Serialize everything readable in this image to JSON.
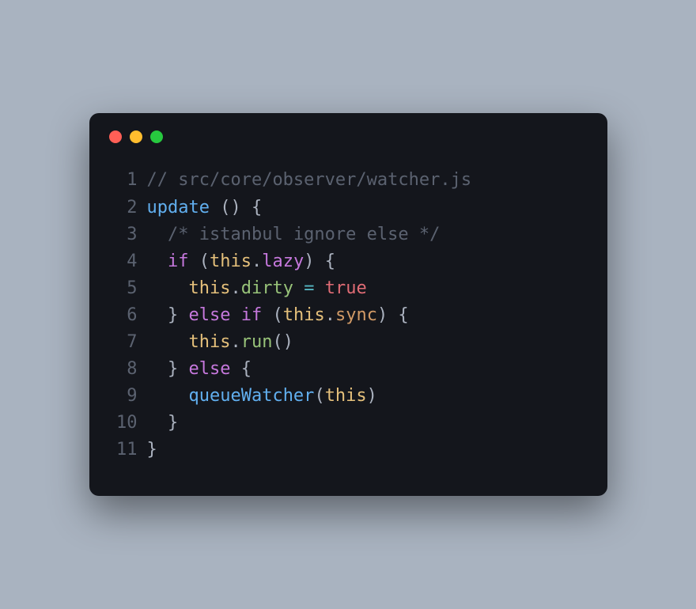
{
  "window": {
    "traffic_lights": [
      "close",
      "minimize",
      "zoom"
    ]
  },
  "code": {
    "lines": [
      {
        "num": "1",
        "tokens": [
          {
            "cls": "tok-comment",
            "text": "// src/core/observer/watcher.js"
          }
        ]
      },
      {
        "num": "2",
        "tokens": [
          {
            "cls": "tok-fn",
            "text": "update"
          },
          {
            "cls": "tok-plain",
            "text": " "
          },
          {
            "cls": "tok-punct",
            "text": "() {"
          }
        ]
      },
      {
        "num": "3",
        "tokens": [
          {
            "cls": "tok-plain",
            "text": "  "
          },
          {
            "cls": "tok-comment",
            "text": "/* istanbul ignore else */"
          }
        ]
      },
      {
        "num": "4",
        "tokens": [
          {
            "cls": "tok-plain",
            "text": "  "
          },
          {
            "cls": "tok-keyword",
            "text": "if"
          },
          {
            "cls": "tok-plain",
            "text": " "
          },
          {
            "cls": "tok-punct",
            "text": "("
          },
          {
            "cls": "tok-this",
            "text": "this"
          },
          {
            "cls": "tok-punct",
            "text": "."
          },
          {
            "cls": "tok-prop-lazy",
            "text": "lazy"
          },
          {
            "cls": "tok-punct",
            "text": ") {"
          }
        ]
      },
      {
        "num": "5",
        "tokens": [
          {
            "cls": "tok-plain",
            "text": "    "
          },
          {
            "cls": "tok-this",
            "text": "this"
          },
          {
            "cls": "tok-punct",
            "text": "."
          },
          {
            "cls": "tok-prop-dirty",
            "text": "dirty"
          },
          {
            "cls": "tok-plain",
            "text": " "
          },
          {
            "cls": "tok-op",
            "text": "="
          },
          {
            "cls": "tok-plain",
            "text": " "
          },
          {
            "cls": "tok-bool",
            "text": "true"
          }
        ]
      },
      {
        "num": "6",
        "tokens": [
          {
            "cls": "tok-plain",
            "text": "  "
          },
          {
            "cls": "tok-punct",
            "text": "}"
          },
          {
            "cls": "tok-plain",
            "text": " "
          },
          {
            "cls": "tok-keyword",
            "text": "else if"
          },
          {
            "cls": "tok-plain",
            "text": " "
          },
          {
            "cls": "tok-punct",
            "text": "("
          },
          {
            "cls": "tok-this",
            "text": "this"
          },
          {
            "cls": "tok-punct",
            "text": "."
          },
          {
            "cls": "tok-prop-sync",
            "text": "sync"
          },
          {
            "cls": "tok-punct",
            "text": ") {"
          }
        ]
      },
      {
        "num": "7",
        "tokens": [
          {
            "cls": "tok-plain",
            "text": "    "
          },
          {
            "cls": "tok-this",
            "text": "this"
          },
          {
            "cls": "tok-punct",
            "text": "."
          },
          {
            "cls": "tok-prop-run",
            "text": "run"
          },
          {
            "cls": "tok-punct",
            "text": "()"
          }
        ]
      },
      {
        "num": "8",
        "tokens": [
          {
            "cls": "tok-plain",
            "text": "  "
          },
          {
            "cls": "tok-punct",
            "text": "}"
          },
          {
            "cls": "tok-plain",
            "text": " "
          },
          {
            "cls": "tok-keyword",
            "text": "else"
          },
          {
            "cls": "tok-plain",
            "text": " "
          },
          {
            "cls": "tok-punct",
            "text": "{"
          }
        ]
      },
      {
        "num": "9",
        "tokens": [
          {
            "cls": "tok-plain",
            "text": "    "
          },
          {
            "cls": "tok-call",
            "text": "queueWatcher"
          },
          {
            "cls": "tok-punct",
            "text": "("
          },
          {
            "cls": "tok-this",
            "text": "this"
          },
          {
            "cls": "tok-punct",
            "text": ")"
          }
        ]
      },
      {
        "num": "10",
        "tokens": [
          {
            "cls": "tok-plain",
            "text": "  "
          },
          {
            "cls": "tok-punct",
            "text": "}"
          }
        ]
      },
      {
        "num": "11",
        "tokens": [
          {
            "cls": "tok-punct",
            "text": "}"
          }
        ]
      }
    ]
  }
}
